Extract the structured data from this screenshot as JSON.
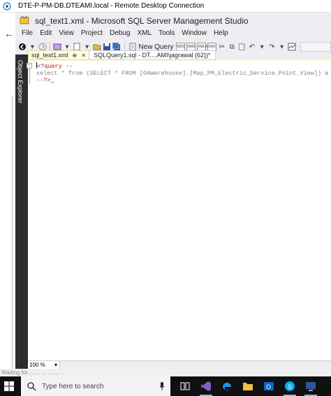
{
  "rdp": {
    "title": "DTE-P-PM-DB.DTEAMI.local - Remote Desktop Connection"
  },
  "ssms": {
    "title": "sql_text1.xml - Microsoft SQL Server Management Studio",
    "menu": [
      "File",
      "Edit",
      "View",
      "Project",
      "Debug",
      "XML",
      "Tools",
      "Window",
      "Help"
    ],
    "toolbar": {
      "new_query_label": "New Query",
      "mini_buttons": [
        "MDX",
        "DMX",
        "XMLA",
        "DAX"
      ]
    },
    "object_explorer_label": "Object Explorer",
    "tabs": [
      {
        "label": "sql_text1.xml",
        "active": true
      },
      {
        "label": "SQLQuery1.sql - DT....AMI\\jagrawal (62))*",
        "active": false
      }
    ],
    "editor": {
      "lines": [
        {
          "prefix": "<",
          "text": "?query --"
        },
        {
          "prefix": "",
          "text": "select * from (SELECT * FROM [OAWarehouse].[Map_PM_Electric_Service_Point_View]) a"
        },
        {
          "prefix": "",
          "text": "--?>"
        }
      ]
    },
    "zoom": "100 %"
  },
  "background": {
    "bottom_text": "Waiting for ... ... ... ... ... ..."
  },
  "taskbar": {
    "search_placeholder": "Type here to search"
  },
  "colors": {
    "object_explorer_bg": "#2d2d30",
    "active_tab_bg": "#ffffe0",
    "taskbar_bg": "#101010",
    "xml_tag": "#a31515"
  }
}
